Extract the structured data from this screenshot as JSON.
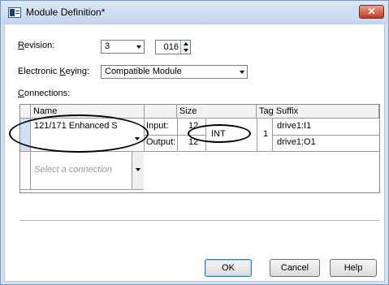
{
  "window": {
    "title": "Module Definition*",
    "close_label": "✕"
  },
  "revision": {
    "label": "Revision:",
    "major": "3",
    "minor": "016"
  },
  "keying": {
    "label": "Electronic Keying:",
    "value": "Compatible Module"
  },
  "connections": {
    "label": "Connections:",
    "headers": {
      "name": "Name",
      "size": "Size",
      "tag_suffix": "Tag Suffix"
    },
    "row": {
      "name": "121/171 Enhanced S",
      "input_label": "Input:",
      "input_size": "12",
      "output_label": "Output:",
      "output_size": "12",
      "data_type": "INT",
      "count": "1",
      "input_tag": "drive1:I1",
      "output_tag": "drive1:O1"
    },
    "new_row_placeholder": "Select a connection"
  },
  "buttons": {
    "ok": "OK",
    "cancel": "Cancel",
    "help": "Help"
  }
}
